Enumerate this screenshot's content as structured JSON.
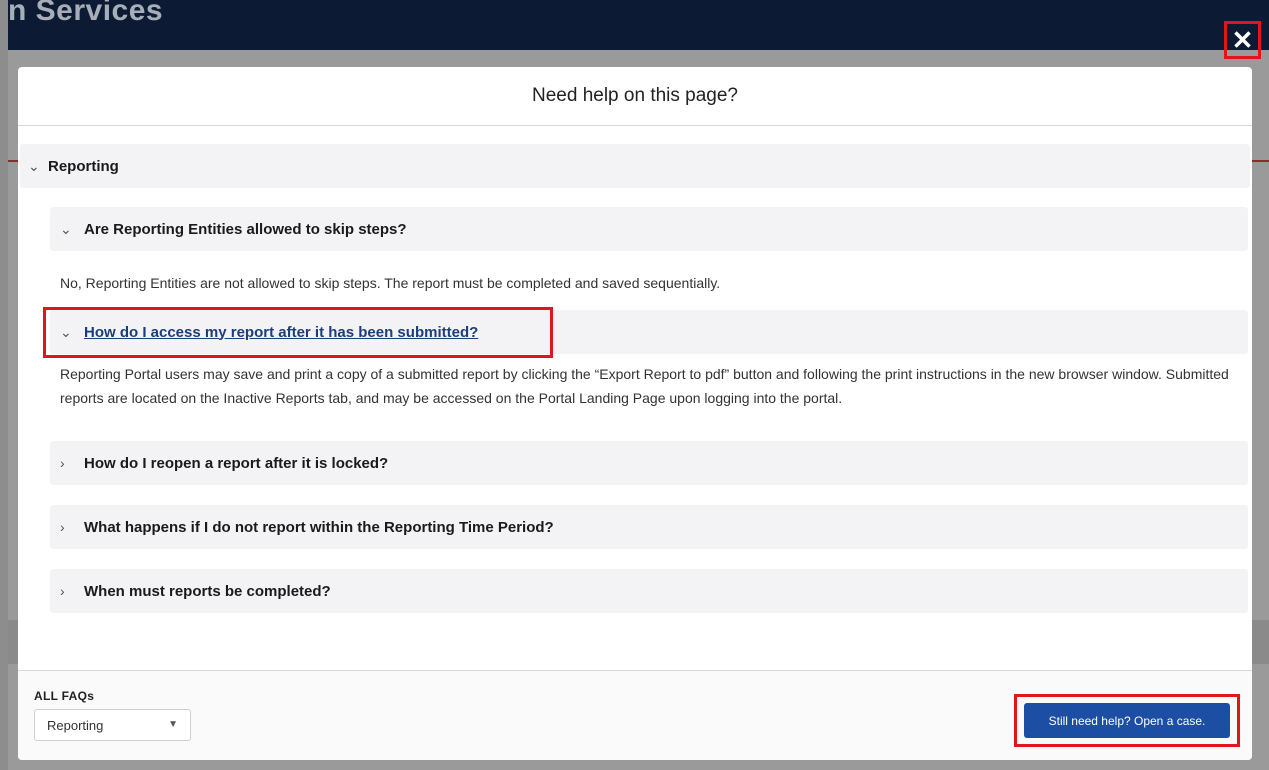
{
  "backdrop": {
    "title": "n Services"
  },
  "close": {
    "glyph": "✕",
    "icon": "close-icon"
  },
  "modal": {
    "title": "Need help on this page?",
    "section": {
      "label": "Reporting",
      "icon": "chevron-down-icon"
    },
    "faqs": [
      {
        "question": "Are Reporting Entities allowed to skip steps?",
        "expanded": true,
        "chevron": "chevron-down-icon"
      },
      {
        "question": "How do I access my report after it has been submitted?",
        "expanded": true,
        "chevron": "chevron-down-icon"
      },
      {
        "question": "How do I reopen a report after it is locked?",
        "expanded": false,
        "chevron": "chevron-right-icon"
      },
      {
        "question": "What happens if I do not report within the Reporting Time Period?",
        "expanded": false,
        "chevron": "chevron-right-icon"
      },
      {
        "question": "When must reports be completed?",
        "expanded": false,
        "chevron": "chevron-right-icon"
      }
    ],
    "answers": {
      "skip_steps": "No, Reporting Entities are not allowed to skip steps.  The report must be completed and saved sequentially.",
      "access_report": "Reporting Portal users may save and print a copy of a submitted report by clicking the “Export Report to pdf” button and following the print instructions in the new browser window. Submitted reports are located on the Inactive Reports tab, and may be accessed on the Portal Landing Page upon logging into the portal."
    }
  },
  "footer": {
    "faqs_label": "ALL FAQs",
    "select_value": "Reporting",
    "case_button": "Still need help? Open a case."
  },
  "colors": {
    "highlight": "#e0161b",
    "primary_button": "#1c4fa3",
    "header_bg": "#0c1b33",
    "link": "#1c3d7a"
  }
}
